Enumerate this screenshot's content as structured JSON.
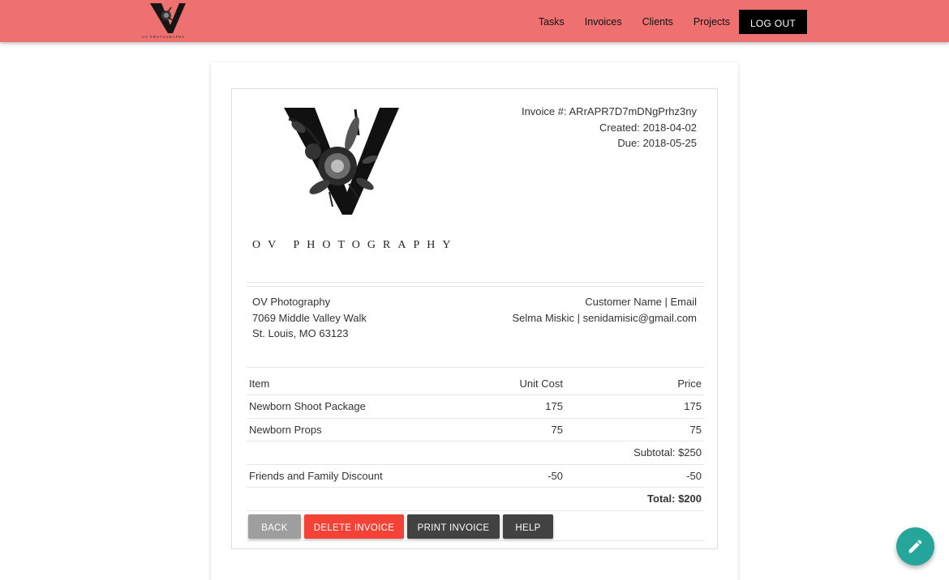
{
  "header": {
    "brand_text": "OV PHOTOGRAPHY",
    "nav": [
      "Tasks",
      "Invoices",
      "Clients",
      "Projects"
    ],
    "logout_label": "LOG OUT",
    "bar_color": "#ef7070"
  },
  "invoice": {
    "logo_text": "OV PHOTOGRAPHY",
    "number_line": "Invoice #: ARrAPR7D7mDNgPrhz3ny",
    "created_line": "Created: 2018-04-02",
    "due_line": "Due: 2018-05-25",
    "from": {
      "name": "OV Photography",
      "street": "7069 Middle Valley Walk",
      "city": "St. Louis, MO 63123"
    },
    "to": {
      "header": "Customer Name | Email",
      "value": "Selma Miskic | senidamisic@gmail.com"
    },
    "table": {
      "headers": [
        "Item",
        "Unit Cost",
        "Price"
      ],
      "rows": [
        [
          "Newborn Shoot Package",
          "175",
          "175"
        ],
        [
          "Newborn Props",
          "75",
          "75"
        ]
      ],
      "subtotal": "Subtotal: $250",
      "discount": [
        "Friends and Family Discount",
        "-50",
        "-50"
      ],
      "total": "Total: $200"
    },
    "buttons": {
      "back": "BACK",
      "delete": "DELETE INVOICE",
      "print": "PRINT INVOICE",
      "help": "HELP"
    }
  },
  "fab": {
    "icon": "pencil-icon",
    "color": "#26a69a"
  }
}
